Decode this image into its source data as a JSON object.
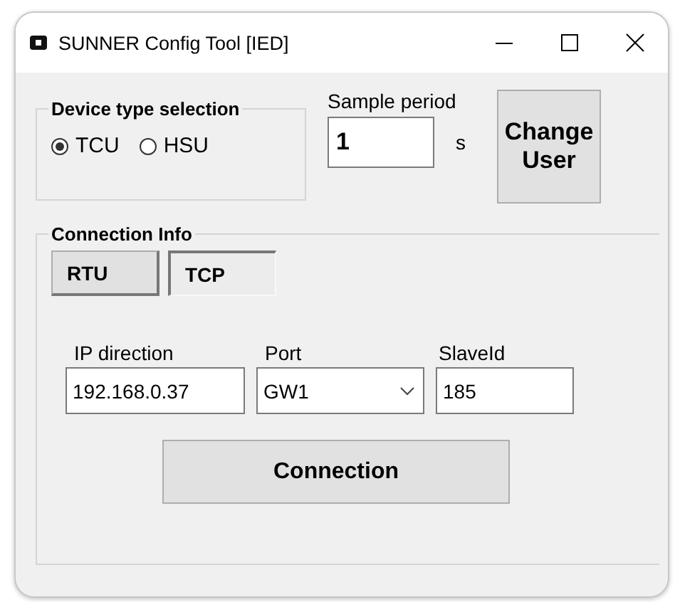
{
  "window": {
    "title": "SUNNER Config Tool [IED]"
  },
  "device_type": {
    "title": "Device type selection",
    "options": [
      {
        "label": "TCU",
        "selected": true
      },
      {
        "label": "HSU",
        "selected": false
      }
    ]
  },
  "sample_period": {
    "label": "Sample period",
    "value": "1",
    "unit": "s"
  },
  "change_user_button": {
    "label": "Change User"
  },
  "connection_info": {
    "title": "Connection Info",
    "modes": [
      {
        "label": "RTU",
        "selected": false
      },
      {
        "label": "TCP",
        "selected": true
      }
    ],
    "ip": {
      "label": "IP direction",
      "value": "192.168.0.37"
    },
    "port": {
      "label": "Port",
      "value": "GW1"
    },
    "slave_id": {
      "label": "SlaveId",
      "value": "185"
    },
    "connect_button": {
      "label": "Connection"
    }
  }
}
